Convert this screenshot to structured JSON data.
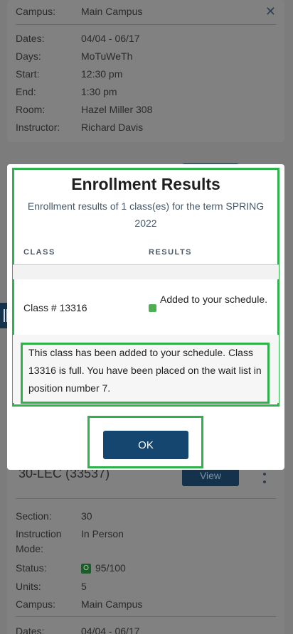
{
  "background": {
    "top_card": {
      "rows": [
        {
          "label": "Campus:",
          "value": "Main Campus"
        },
        {
          "label": "Dates:",
          "value": "04/04 - 06/17"
        },
        {
          "label": "Days:",
          "value": "MoTuWeTh"
        },
        {
          "label": "Start:",
          "value": "12:30 pm"
        },
        {
          "label": "End:",
          "value": "1:30 pm"
        },
        {
          "label": "Room:",
          "value": "Hazel Miller 308"
        },
        {
          "label": "Instructor:",
          "value": "Richard Davis"
        }
      ]
    },
    "bottom_card": {
      "title": "30-LEC (33537)",
      "view_label": "View",
      "rows": [
        {
          "label": "Section:",
          "value": "30"
        },
        {
          "label": "Instruction",
          "value": "In Person"
        },
        {
          "label": "Mode:",
          "value": ""
        },
        {
          "label": "Status:",
          "value": "95/100",
          "badge": "O"
        },
        {
          "label": "Units:",
          "value": "5"
        },
        {
          "label": "Campus:",
          "value": "Main Campus"
        },
        {
          "label": "Dates:",
          "value": "04/04 - 06/17"
        }
      ]
    }
  },
  "modal": {
    "title": "Enrollment Results",
    "subtitle": "Enrollment results of 1 class(es) for the term SPRING 2022",
    "columns": [
      "CLASS",
      "RESULTS"
    ],
    "row": {
      "class": "Class # 13316",
      "result": "Added to your schedule.",
      "status_color": "#4caf50"
    },
    "message": "This class has been added to your schedule. Class 13316 is full. You have been placed on the wait list in position number 7.",
    "ok_label": "OK"
  },
  "colors": {
    "highlight": "#2fb24b",
    "primary_button": "#15466f"
  }
}
